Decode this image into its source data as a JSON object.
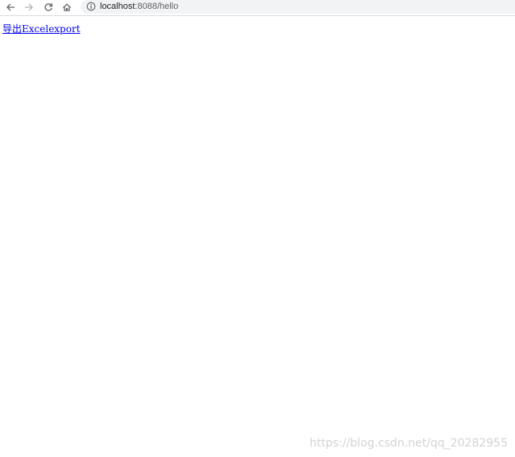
{
  "browser": {
    "url_host": "localhost",
    "url_rest": ":8088/hello",
    "icons": {
      "back": "arrow-left-icon",
      "forward": "arrow-right-icon",
      "reload": "reload-icon",
      "home": "home-icon",
      "site_info": "info-circle-icon"
    }
  },
  "page": {
    "link_text": "导出Excelexport",
    "link_color": "#0000ee"
  },
  "watermark": {
    "text": "https://blog.csdn.net/qq_20282955"
  }
}
